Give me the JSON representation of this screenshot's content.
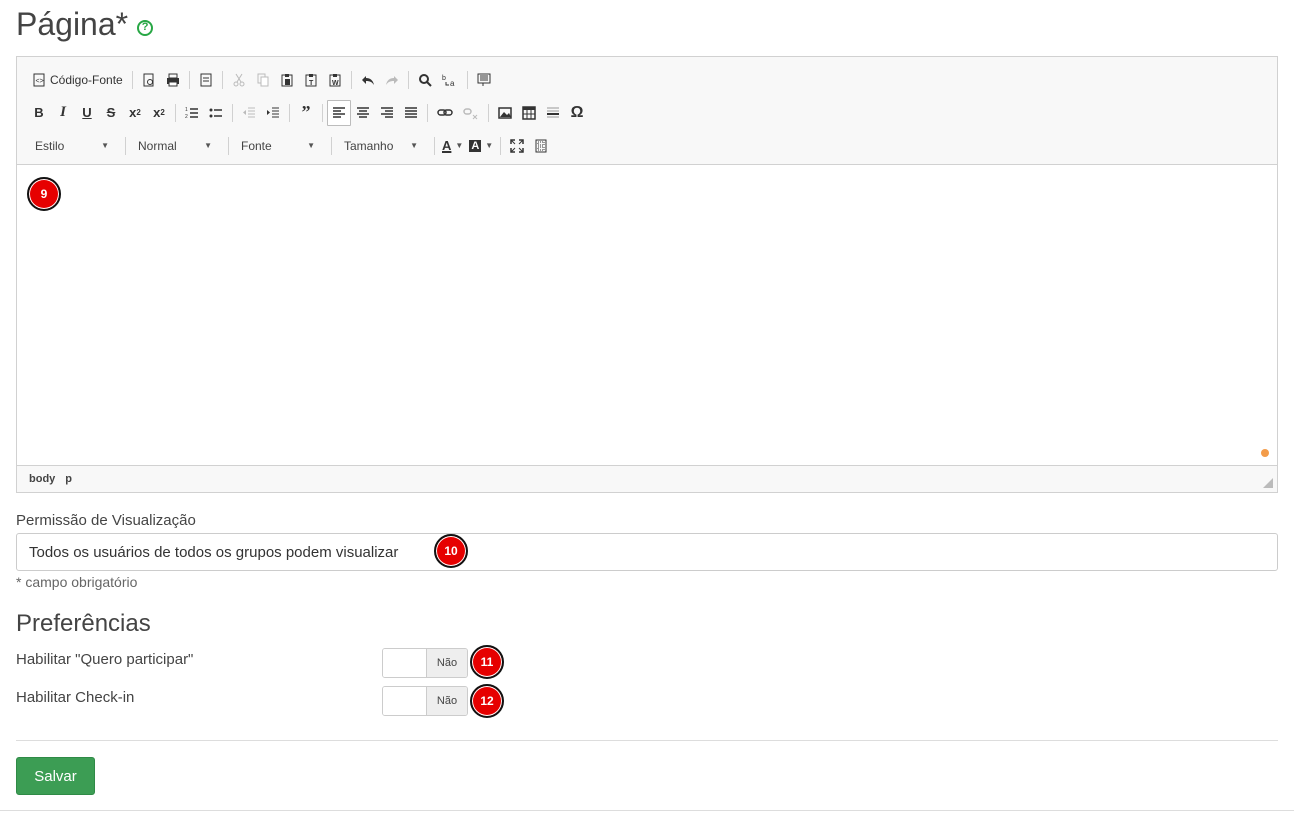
{
  "page": {
    "title": "Página*"
  },
  "editor": {
    "toolbar": {
      "source_label": "Código-Fonte",
      "combos": {
        "style": "Estilo",
        "format": "Normal",
        "font": "Fonte",
        "size": "Tamanho"
      }
    },
    "path": [
      "body",
      "p"
    ],
    "content": ""
  },
  "visibility": {
    "label": "Permissão de Visualização",
    "value": "Todos os usuários de todos os grupos podem visualizar",
    "hint": "* campo obrigatório"
  },
  "preferences": {
    "title": "Preferências",
    "items": [
      {
        "label": "Habilitar \"Quero participar\"",
        "state": "Não"
      },
      {
        "label": "Habilitar Check-in",
        "state": "Não"
      }
    ]
  },
  "actions": {
    "save_label": "Salvar"
  },
  "badges": [
    "9",
    "10",
    "11",
    "12"
  ],
  "colors": {
    "save": "#3c9d54",
    "help": "#28a745",
    "badge": "#e60000"
  }
}
